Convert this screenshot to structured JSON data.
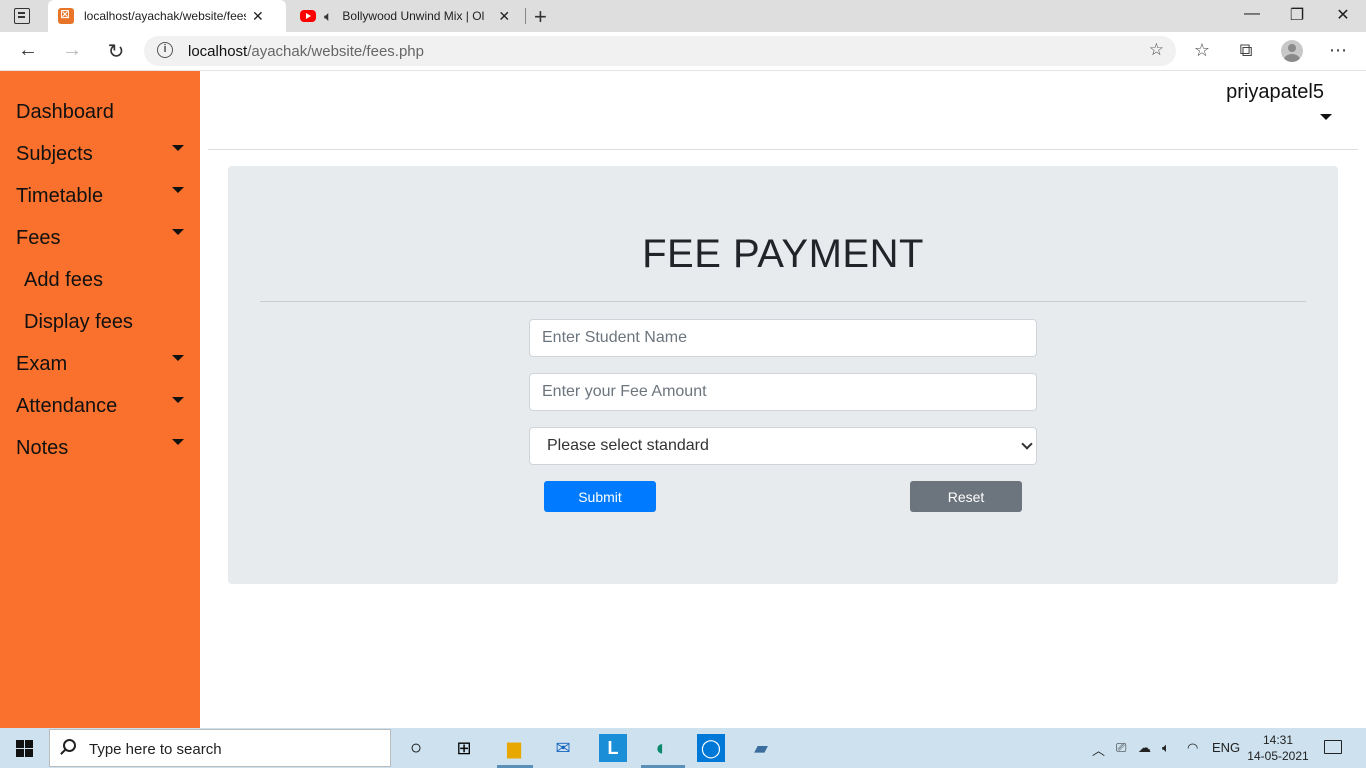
{
  "browser": {
    "tabs": [
      {
        "title": "localhost/ayachak/website/fees.p",
        "active": true
      },
      {
        "title": "Bollywood Unwind Mix | Ol",
        "active": false
      }
    ],
    "url_host": "localhost",
    "url_path": "/ayachak/website/fees.php"
  },
  "sidebar": {
    "items": [
      {
        "label": "Dashboard"
      },
      {
        "label": "Subjects"
      },
      {
        "label": "Timetable"
      },
      {
        "label": "Fees"
      },
      {
        "label": "Add fees"
      },
      {
        "label": "Display fees"
      },
      {
        "label": "Exam"
      },
      {
        "label": "Attendance"
      },
      {
        "label": "Notes"
      }
    ]
  },
  "header": {
    "username": "priyapatel5"
  },
  "form": {
    "title": "FEE PAYMENT",
    "student_name_placeholder": "Enter Student Name",
    "fee_amount_placeholder": "Enter your Fee Amount",
    "standard_selected": "Please select standard",
    "submit_label": "Submit",
    "reset_label": "Reset"
  },
  "taskbar": {
    "search_placeholder": "Type here to search",
    "language": "ENG",
    "time": "14:31",
    "date": "14-05-2021"
  },
  "colors": {
    "sidebar": "#f9712d",
    "panel": "#e8ebee",
    "submit": "#007bff",
    "reset": "#6c757d"
  }
}
